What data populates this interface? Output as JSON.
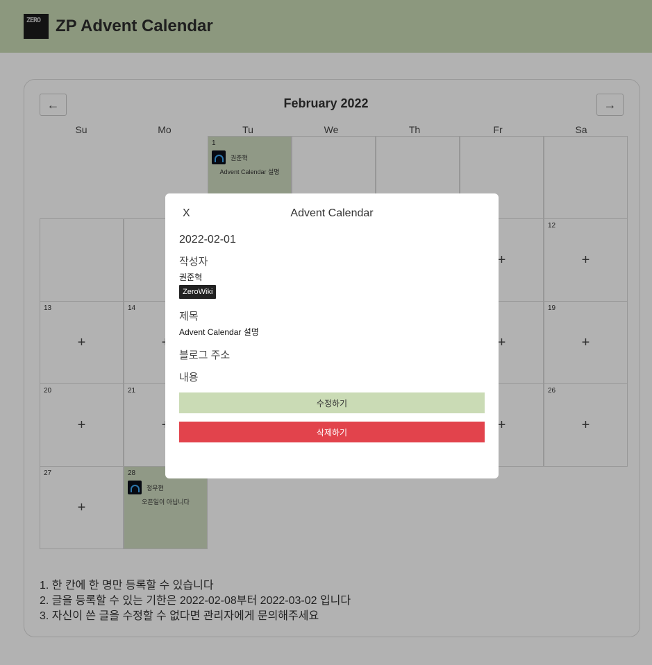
{
  "header": {
    "logo_text": "ZERO",
    "title": "ZP Advent Calendar"
  },
  "calendar": {
    "month_title": "February 2022",
    "prev_icon": "←",
    "next_icon": "→",
    "weekdays": [
      "Su",
      "Mo",
      "Tu",
      "We",
      "Th",
      "Fr",
      "Sa"
    ],
    "add_symbol": "+",
    "days": {
      "d1": {
        "num": "1",
        "author": "권준혁",
        "title": "Advent Calendar 설명"
      },
      "d12": "12",
      "d13": "13",
      "d14": "14",
      "d19": "19",
      "d20": "20",
      "d21": "21",
      "d26": "26",
      "d27": "27",
      "d28": {
        "num": "28",
        "author": "정우현",
        "title": "오픈일이 아닙니다"
      }
    }
  },
  "rules": [
    "1. 한 칸에 한 명만 등록할 수 있습니다",
    "2. 글을 등록할 수 있는 기한은 2022-02-08부터 2022-03-02 입니다",
    "3. 자신이 쓴 글을 수정할 수 없다면 관리자에게 문의해주세요"
  ],
  "modal": {
    "close_label": "X",
    "title": "Advent Calendar",
    "date": "2022-02-01",
    "author_label": "작성자",
    "author": "권준혁",
    "badge": "ZeroWiki",
    "title_label": "제목",
    "post_title": "Advent Calendar 설명",
    "blog_label": "블로그 주소",
    "content_label": "내용",
    "edit_label": "수정하기",
    "delete_label": "삭제하기"
  }
}
